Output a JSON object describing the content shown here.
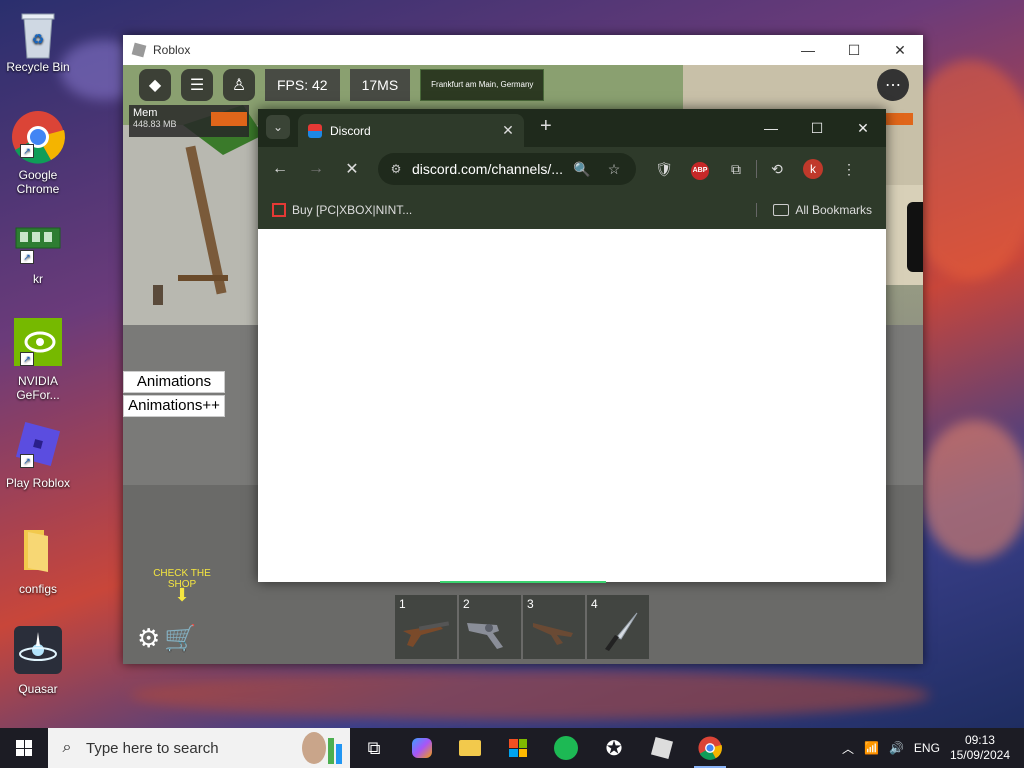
{
  "desktop": {
    "icons": [
      {
        "label": "Recycle Bin",
        "icon": "recycle-bin-icon"
      },
      {
        "label": "Google Chrome",
        "icon": "chrome-icon"
      },
      {
        "label": "kr",
        "icon": "memory-chip-icon"
      },
      {
        "label": "NVIDIA GeFor...",
        "icon": "nvidia-icon"
      },
      {
        "label": "Play Roblox",
        "icon": "roblox-icon"
      },
      {
        "label": "configs",
        "icon": "folder-icon"
      },
      {
        "label": "Quasar",
        "icon": "quasar-icon"
      }
    ]
  },
  "roblox": {
    "window_title": "Roblox",
    "fps": "FPS: 42",
    "ping": "17MS",
    "location": "Frankfurt am Main, Germany",
    "mem_label": "Mem",
    "mem_value": "448.83 MB",
    "buttons": {
      "animations": "Animations",
      "animations_plus": "Animations++"
    },
    "shop_hint": "CHECK THE SHOP",
    "hotbar": [
      {
        "num": "1",
        "icon": "shotgun-icon"
      },
      {
        "num": "2",
        "icon": "revolver-icon"
      },
      {
        "num": "3",
        "icon": "rifle-icon"
      },
      {
        "num": "4",
        "icon": "knife-icon"
      }
    ]
  },
  "chrome": {
    "tab_title": "Discord",
    "url": "discord.com/channels/...",
    "bookmark": "Buy [PC|XBOX|NINT...",
    "all_bookmarks": "All Bookmarks",
    "profile_initial": "k",
    "abp_label": "ABP"
  },
  "taskbar": {
    "search_placeholder": "Type here to search",
    "lang": "ENG",
    "time": "09:13",
    "date": "15/09/2024"
  }
}
